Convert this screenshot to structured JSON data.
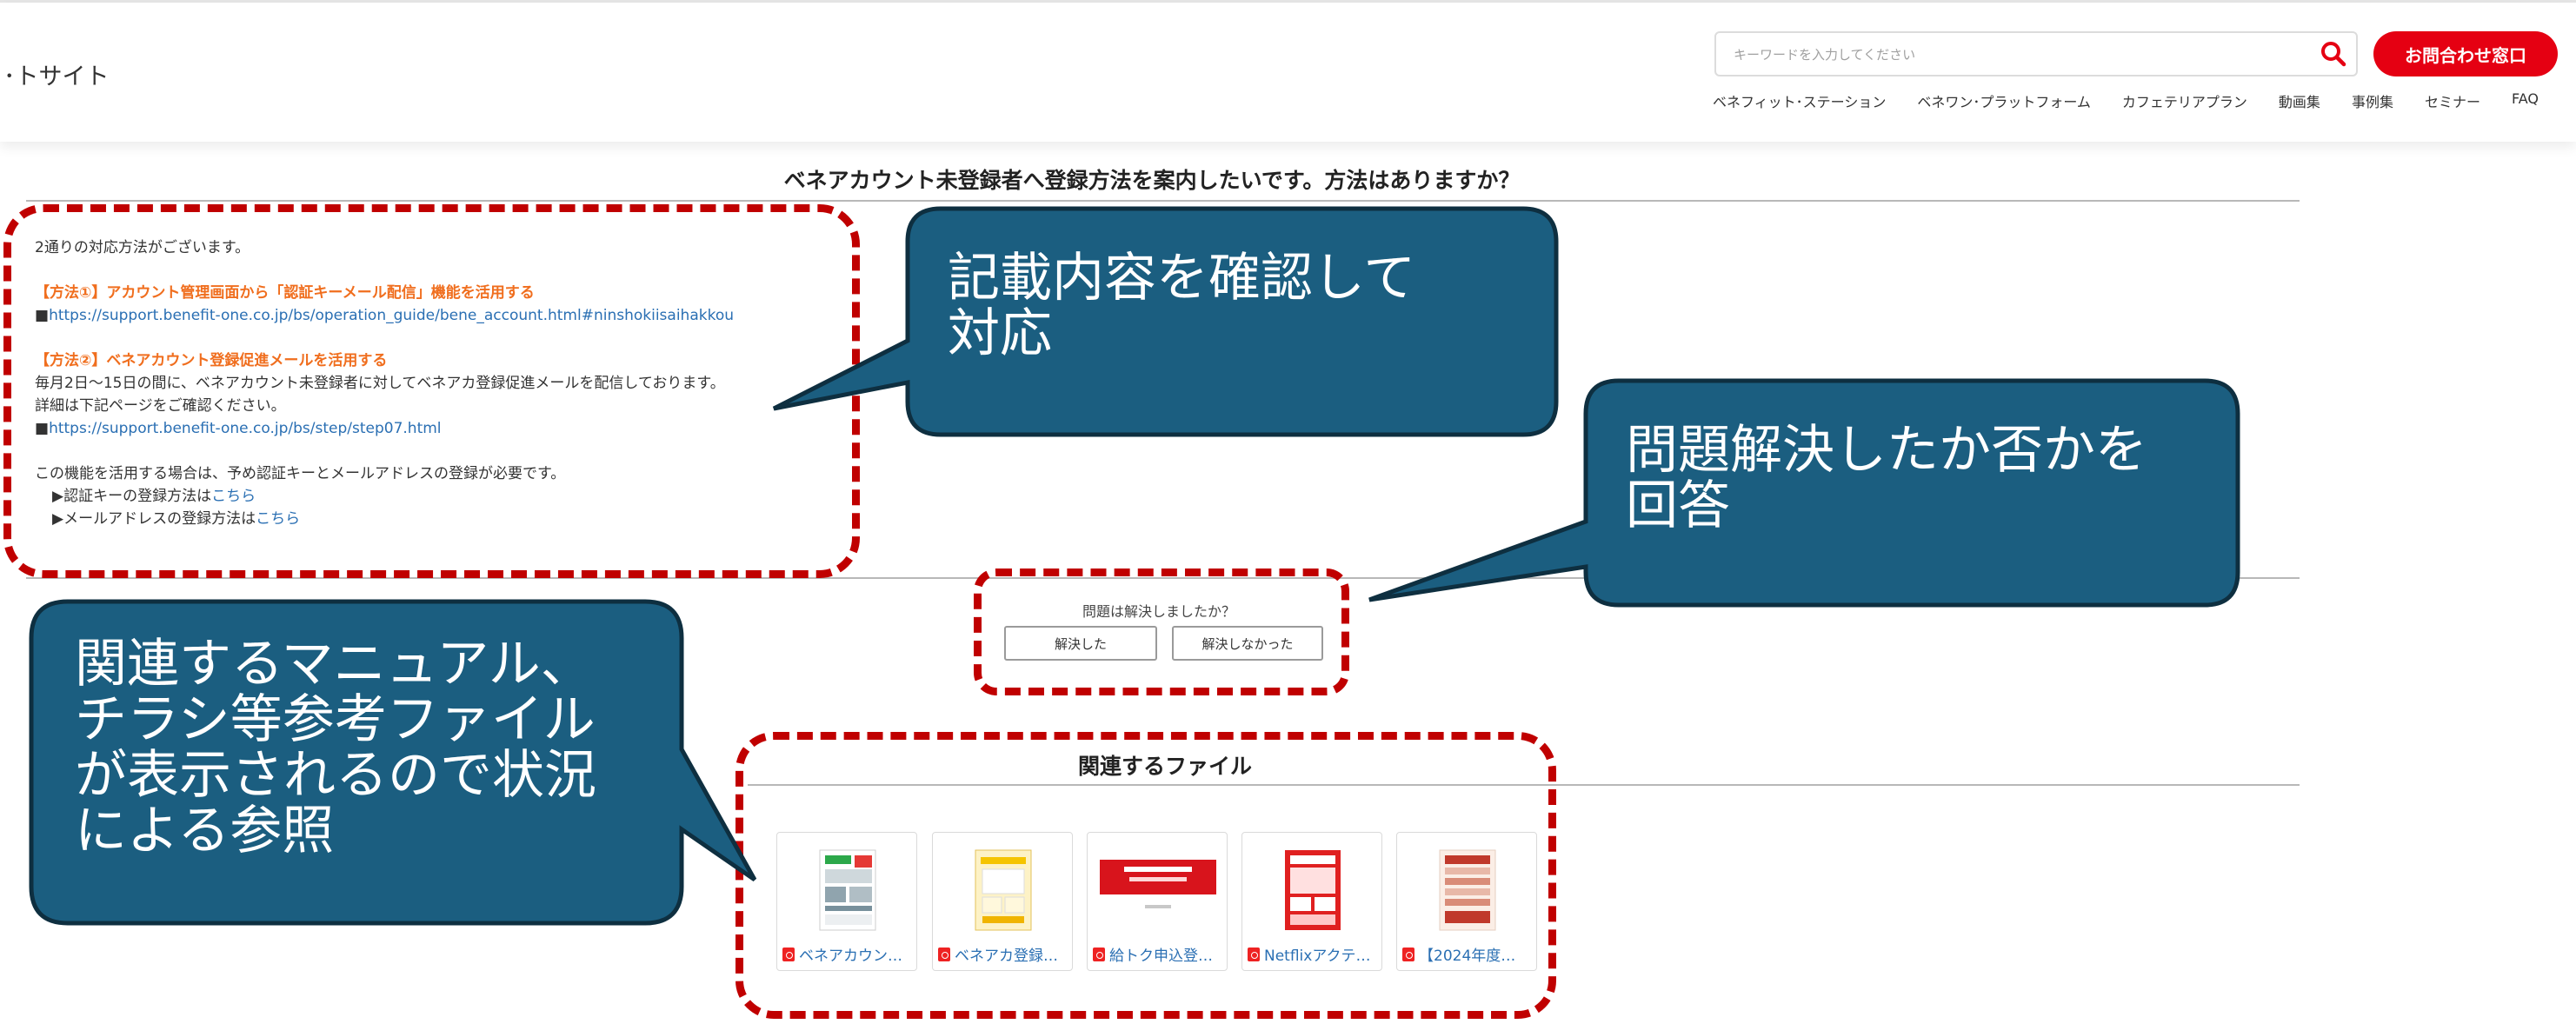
{
  "header": {
    "site_name": "･トサイト",
    "search_placeholder": "キーワードを入力してください",
    "contact_label": "お問合わせ窓口",
    "nav": [
      "ベネフィット･ステーション",
      "ベネワン･プラットフォーム",
      "カフェテリアプラン",
      "動画集",
      "事例集",
      "セミナー",
      "FAQ"
    ]
  },
  "faq": {
    "title": "ベネアカウント未登録者へ登録方法を案内したいです。方法はありますか？",
    "intro": "2通りの対応方法がございます。",
    "method1_title": "【方法①】アカウント管理画面から「認証キーメール配信」機能を活用する",
    "method1_link": "https://support.benefit-one.co.jp/bs/operation_guide/bene_account.html#ninshokiisaihakkou",
    "method2_title": "【方法②】ベネアカウント登録促進メールを活用する",
    "method2_line1": "毎月2日～15日の間に、ベネアカウント未登録者に対してベネアカ登録促進メールを配信しております。",
    "method2_line2": "詳細は下記ページをご確認ください。",
    "method2_link": "https://support.benefit-one.co.jp/bs/step/step07.html",
    "note": "この機能を活用する場合は、予め認証キーとメールアドレスの登録が必要です。",
    "bullet1_prefix": "▶認証キーの登録方法は",
    "bullet2_prefix": "▶メールアドレスの登録方法は",
    "here_link": "こちら",
    "square_bullet": "■"
  },
  "feedback": {
    "question": "問題は解決しましたか？",
    "yes_label": "解決した",
    "no_label": "解決しなかった"
  },
  "related": {
    "title": "関連するファイル",
    "files": [
      {
        "name": "ベネアカウン…"
      },
      {
        "name": "ベネアカ登録…"
      },
      {
        "name": "給トク申込登…"
      },
      {
        "name": "Netflixアクテ…"
      },
      {
        "name": "【2024年度…"
      }
    ]
  },
  "callouts": {
    "c1": [
      "記載内容を確認して",
      "対応"
    ],
    "c2": [
      "問題解決したか否かを",
      "回答"
    ],
    "c3": [
      "関連するマニュアル、",
      "チラシ等参考ファイル",
      "が表示されるので状況",
      "による参照"
    ]
  },
  "colors": {
    "accent": "#e50012",
    "link": "#2a6fb3",
    "orange": "#f06e1e",
    "callout_fill": "#1b5e80",
    "dash": "#c00000"
  }
}
